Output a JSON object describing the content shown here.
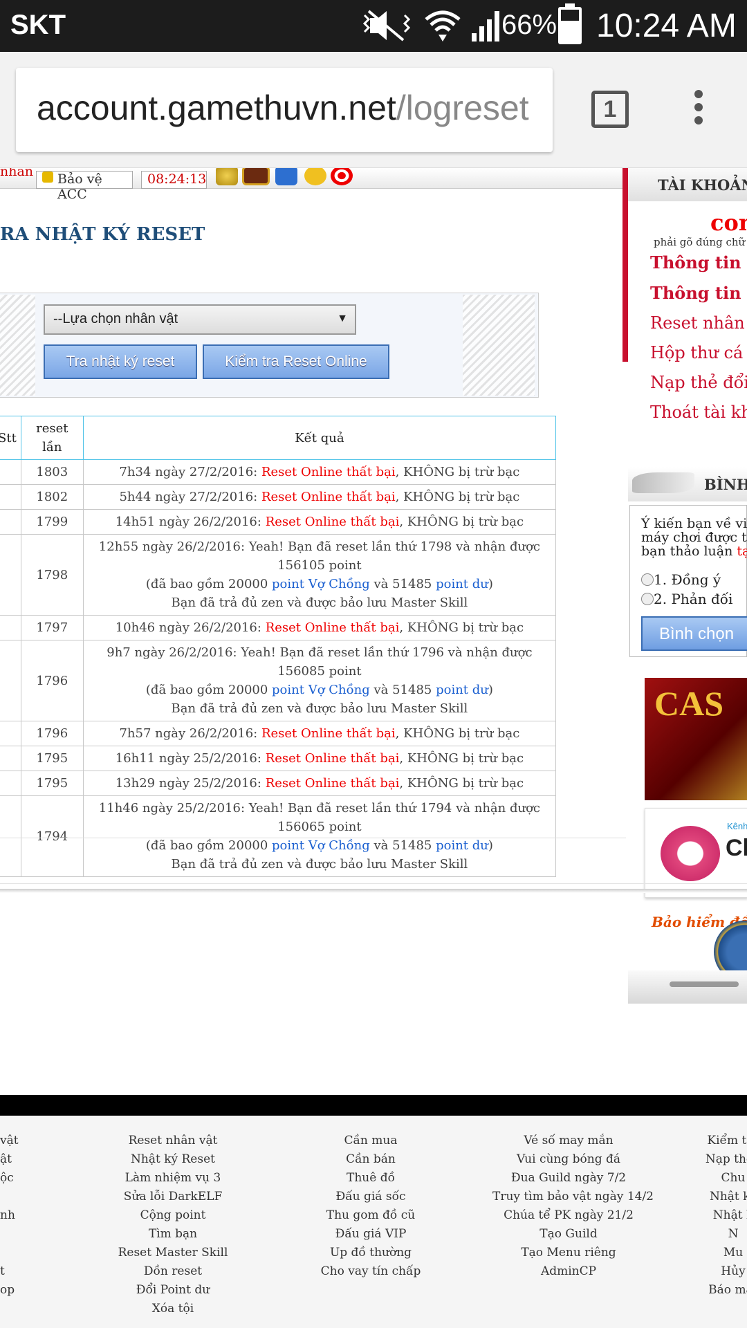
{
  "status_bar": {
    "carrier": "SKT",
    "battery_percent": "66%",
    "time": "10:24 AM"
  },
  "browser": {
    "url_host": "account.gamethuvn.net",
    "url_path": "/logreset",
    "tab_count": "1"
  },
  "top_strip": {
    "user_text": "nhan",
    "protect_label": "Bảo vệ ACC",
    "clock": "08:24:13"
  },
  "main": {
    "section_title": "KIỂM TRA NHẬT KÝ RESET",
    "select_value": "--Lựa chọn nhân vật",
    "btn_log": "Tra nhật ký reset",
    "btn_online": "Kiểm tra Reset Online"
  },
  "table": {
    "headers": [
      "Stt",
      "reset lần",
      "Kết quả"
    ],
    "rows": [
      {
        "count": "1803",
        "time": "7h34 ngày 27/2/2016: ",
        "fail": "Reset Online thất bại",
        "note": ", KHÔNG bị trừ bạc"
      },
      {
        "count": "1802",
        "time": "5h44 ngày 27/2/2016: ",
        "fail": "Reset Online thất bại",
        "note": ", KHÔNG bị trừ bạc"
      },
      {
        "count": "1799",
        "time": "14h51 ngày 26/2/2016: ",
        "fail": "Reset Online thất bại",
        "note": ", KHÔNG bị trừ bạc"
      },
      {
        "count": "1798",
        "line1": "12h55 ngày 26/2/2016: Yeah! Bạn đã reset lần thứ 1798 và nhận được 156105 point",
        "l2a": "(đã bao gồm 20000 ",
        "l2b": "point Vợ Chồng",
        "l2c": " và 51485 ",
        "l2d": "point dư",
        "l2e": ")",
        "line3": "Bạn đã trả đủ zen và được bảo lưu Master Skill"
      },
      {
        "count": "1797",
        "time": "10h46 ngày 26/2/2016: ",
        "fail": "Reset Online thất bại",
        "note": ", KHÔNG bị trừ bạc"
      },
      {
        "count": "1796",
        "line1": "9h7 ngày 26/2/2016: Yeah! Bạn đã reset lần thứ 1796 và nhận được 156085 point",
        "l2a": "(đã bao gồm 20000 ",
        "l2b": "point Vợ Chồng",
        "l2c": " và 51485 ",
        "l2d": "point dư",
        "l2e": ")",
        "line3": "Bạn đã trả đủ zen và được bảo lưu Master Skill"
      },
      {
        "count": "1796",
        "time": "7h57 ngày 26/2/2016: ",
        "fail": "Reset Online thất bại",
        "note": ", KHÔNG bị trừ bạc"
      },
      {
        "count": "1795",
        "time": "16h11 ngày 25/2/2016: ",
        "fail": "Reset Online thất bại",
        "note": ", KHÔNG bị trừ bạc"
      },
      {
        "count": "1795",
        "time": "13h29 ngày 25/2/2016: ",
        "fail": "Reset Online thất bại",
        "note": ", KHÔNG bị trừ bạc"
      },
      {
        "count": "1794",
        "line1": "11h46 ngày 25/2/2016: Yeah! Bạn đã reset lần thứ 1794 và nhận được 156065 point",
        "l2a": "(đã bao gồm 20000 ",
        "l2b": "point Vợ Chồng",
        "l2c": " và 51485 ",
        "l2d": "point dư",
        "l2e": ")",
        "line3": "Bạn đã trả đủ zen và được bảo lưu Master Skill"
      }
    ]
  },
  "sidebar": {
    "account_head": "TÀI KHOẢN",
    "con_text": "con",
    "note": "phải gõ đúng chữ H",
    "links": [
      "Thông tin tà",
      "Thông tin n",
      "Reset nhân v",
      "Hộp thư cá n",
      "Nạp thẻ đổi",
      "Thoát tài kho"
    ],
    "poll_head": "BÌNH C",
    "poll_question": [
      "Ý kiến bạn về việ",
      "máy chơi được tố",
      "bạn thảo luận "
    ],
    "poll_link": "tạ",
    "poll_options": [
      "1. Đồng ý",
      "2. Phản đối"
    ],
    "vote_button": "Bình chọn",
    "banner_casino": "CAS",
    "banner_chat_kenh": "Kênh",
    "banner_chat": "Ch",
    "banner_insurance": "Bảo hiểm đồ"
  },
  "footer": {
    "col1": [
      "vật",
      "ật",
      "ộc",
      "",
      "nh",
      "",
      "",
      "t",
      "op"
    ],
    "col2": [
      "Reset nhân vật",
      "Nhật ký Reset",
      "Làm nhiệm vụ 3",
      "Sửa lỗi DarkELF",
      "Cộng point",
      "Tìm bạn",
      "Reset Master Skill",
      "Dồn reset",
      "Đổi Point dư",
      "Xóa tội"
    ],
    "col3": [
      "Cần mua",
      "Cần bán",
      "Thuê đồ",
      "Đấu giá sốc",
      "Thu gom đồ cũ",
      "Đấu giá VIP",
      "Up đồ thường",
      "Cho vay tín chấp"
    ],
    "col4": [
      "Vé số may mắn",
      "Vui cùng bóng đá",
      "Đua Guild ngày 7/2",
      "Truy tìm bảo vật ngày 14/2",
      "Chúa tể PK ngày 21/2",
      "Tạo Guild",
      "Tạo Menu riêng",
      "AdminCP"
    ],
    "col5": [
      "Kiểm tra",
      "Nạp thẻ -",
      "Chu",
      "Nhật ký",
      "Nhật k",
      "N",
      "Mu",
      "Hủy",
      "Báo mất"
    ]
  }
}
